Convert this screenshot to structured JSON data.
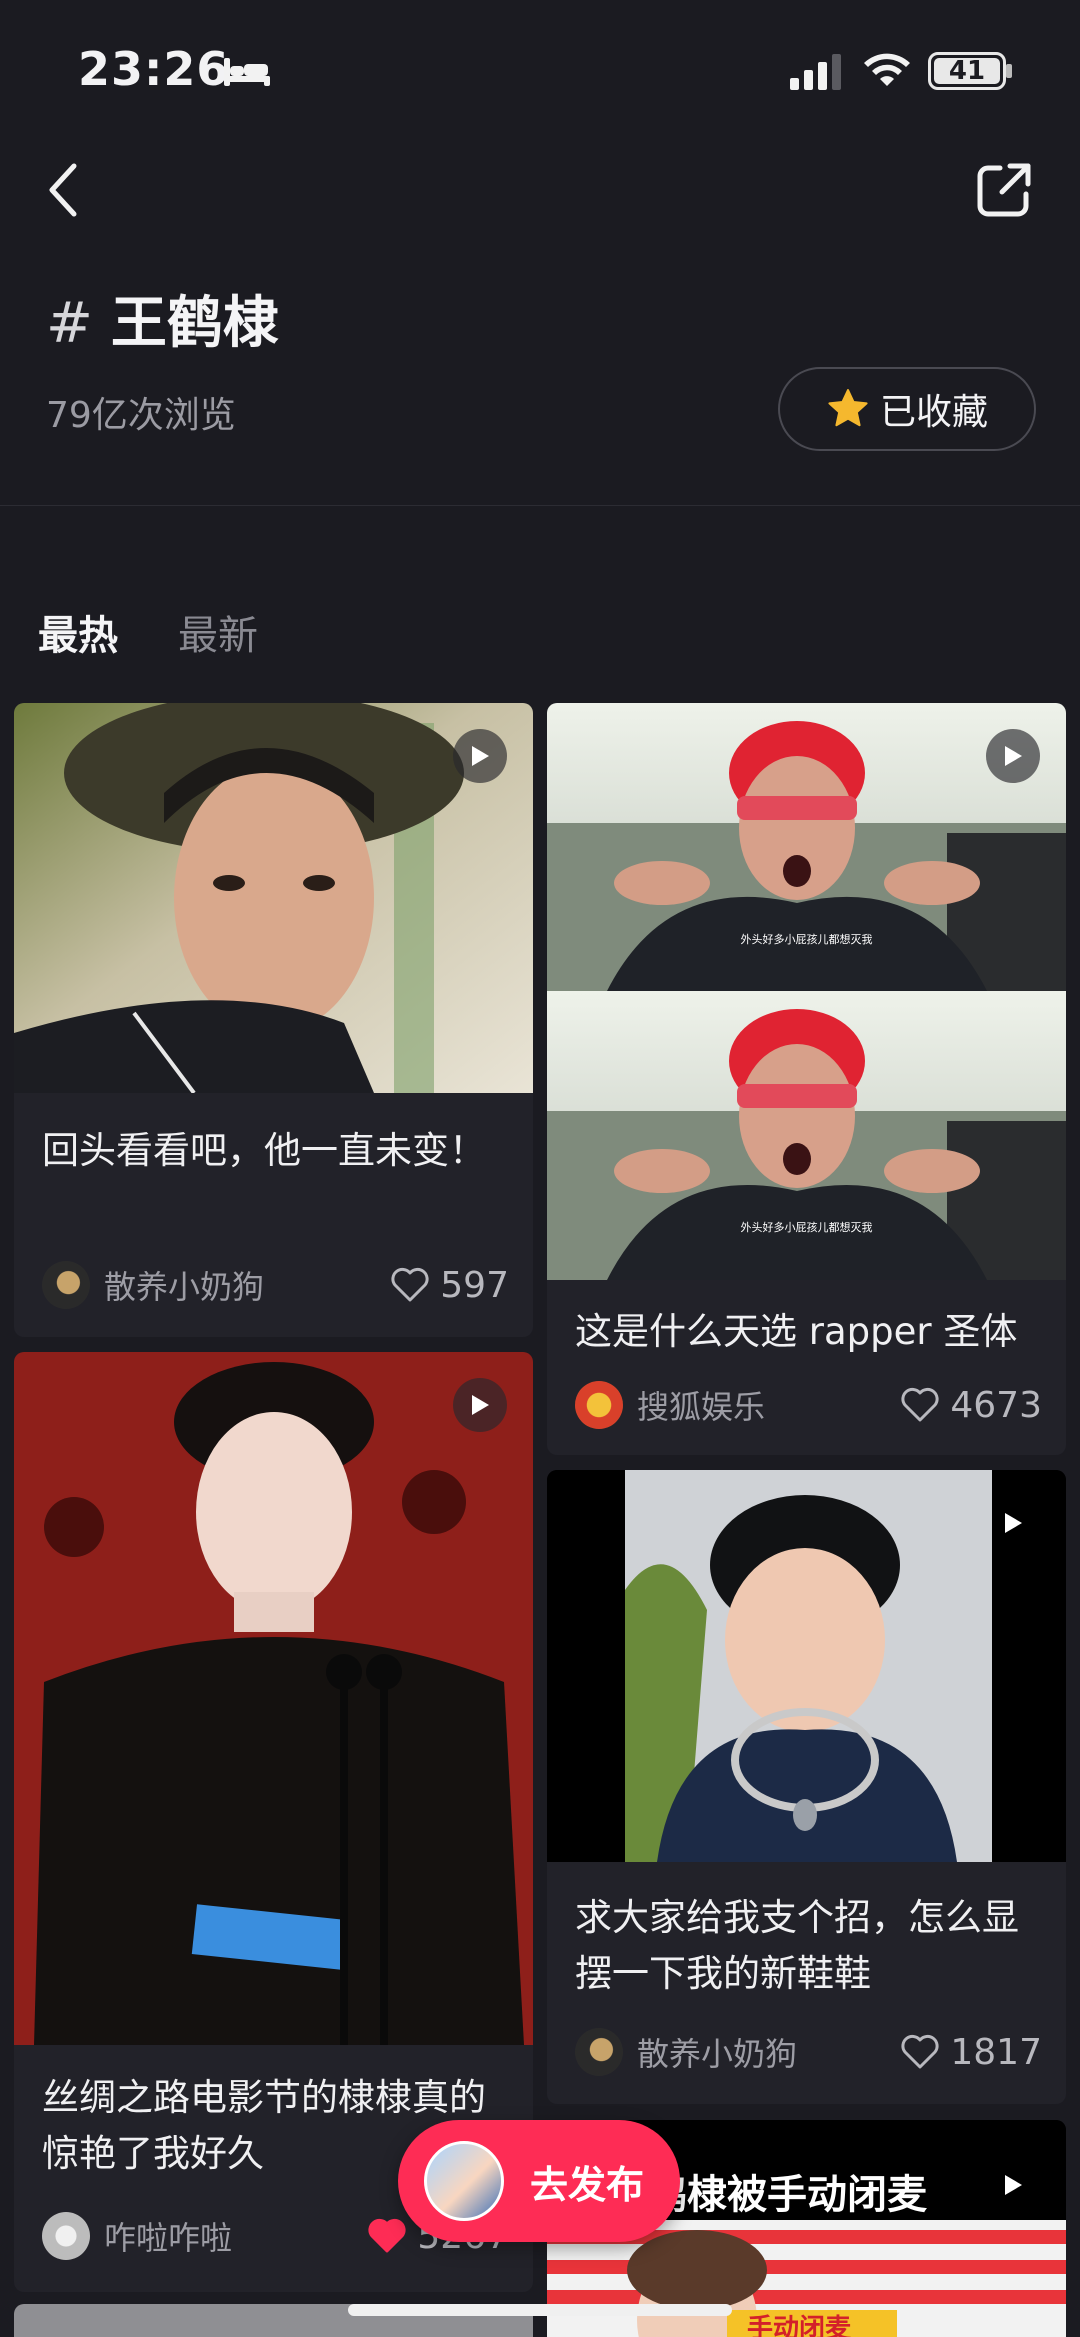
{
  "status_bar": {
    "time": "23:26",
    "battery": "41"
  },
  "topic": {
    "hash": "#",
    "name": "王鹤棣",
    "views": "79亿次浏览"
  },
  "favorite_button": {
    "label": "已收藏"
  },
  "tabs": [
    {
      "label": "最热",
      "active": true
    },
    {
      "label": "最新",
      "active": false
    }
  ],
  "posts": [
    {
      "title": "回头看看吧，他一直未变！",
      "author": "散养小奶狗",
      "likes": "597",
      "liked": false
    },
    {
      "title": "这是什么天选 rapper 圣体",
      "author": "搜狐娱乐",
      "likes": "4673",
      "liked": false,
      "subtitle": "外头好多小屁孩儿都想灭我"
    },
    {
      "title": "丝绸之路电影节的棣棣真的惊艳了我好久",
      "author": "咋啦咋啦",
      "likes": "5267",
      "liked": true
    },
    {
      "title": "求大家给我支个招，怎么显摆一下我的新鞋鞋",
      "author": "散养小奶狗",
      "likes": "1817",
      "liked": false
    },
    {
      "title": "王鹤棣被手动闭麦",
      "overlay": "手动闭麦"
    }
  ],
  "publish_button": {
    "label": "去发布"
  },
  "colors": {
    "background": "#1b1b21",
    "card": "#222229",
    "accent": "#fe2c55",
    "star": "#f5b82e"
  },
  "icons": [
    "back-icon",
    "share-icon",
    "star-icon",
    "play-icon",
    "heart-outline-icon",
    "heart-filled-icon"
  ]
}
